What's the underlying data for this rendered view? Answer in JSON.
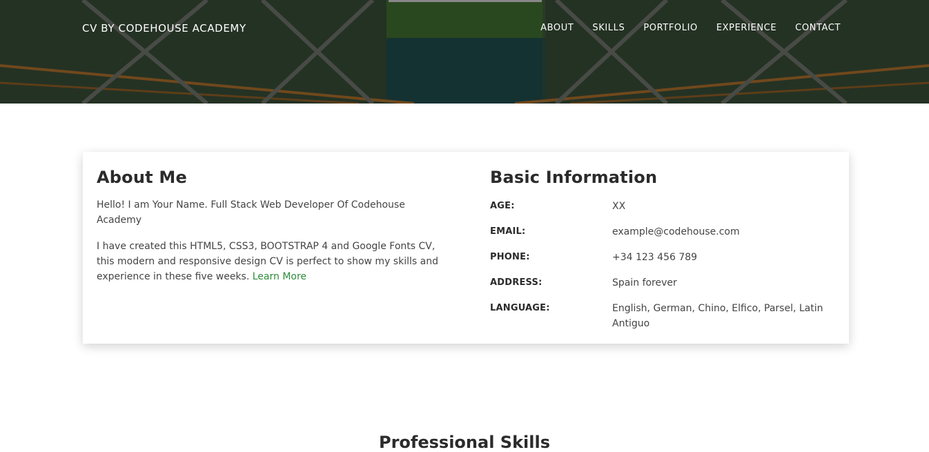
{
  "header": {
    "brand": "CV BY CODEHOUSE ACADEMY",
    "nav": [
      "ABOUT",
      "SKILLS",
      "PORTFOLIO",
      "EXPERIENCE",
      "CONTACT"
    ],
    "background_image": "bridge-over-lake-photo"
  },
  "about": {
    "title": "About Me",
    "para1": "Hello! I am Your Name. Full Stack Web Developer Of Codehouse Academy",
    "para2": "I have created this HTML5, CSS3, BOOTSTRAP 4 and Google Fonts CV, this modern and responsive design CV is perfect to show my skills and experience in these five weeks.",
    "learn_more": "Learn More"
  },
  "basic": {
    "title": "Basic Information",
    "rows": [
      {
        "label": "AGE:",
        "value": "XX"
      },
      {
        "label": "EMAIL:",
        "value": "example@codehouse.com"
      },
      {
        "label": "PHONE:",
        "value": "+34 123 456 789"
      },
      {
        "label": "ADDRESS:",
        "value": "Spain forever"
      },
      {
        "label": "LANGUAGE:",
        "value": "English, German, Chino, Elfico, Parsel, Latin Antiguo"
      }
    ]
  },
  "skills": {
    "title": "Professional Skills"
  },
  "colors": {
    "link_green": "#2e8b3a",
    "heading": "#2b2b2b",
    "body_text": "#444444"
  }
}
